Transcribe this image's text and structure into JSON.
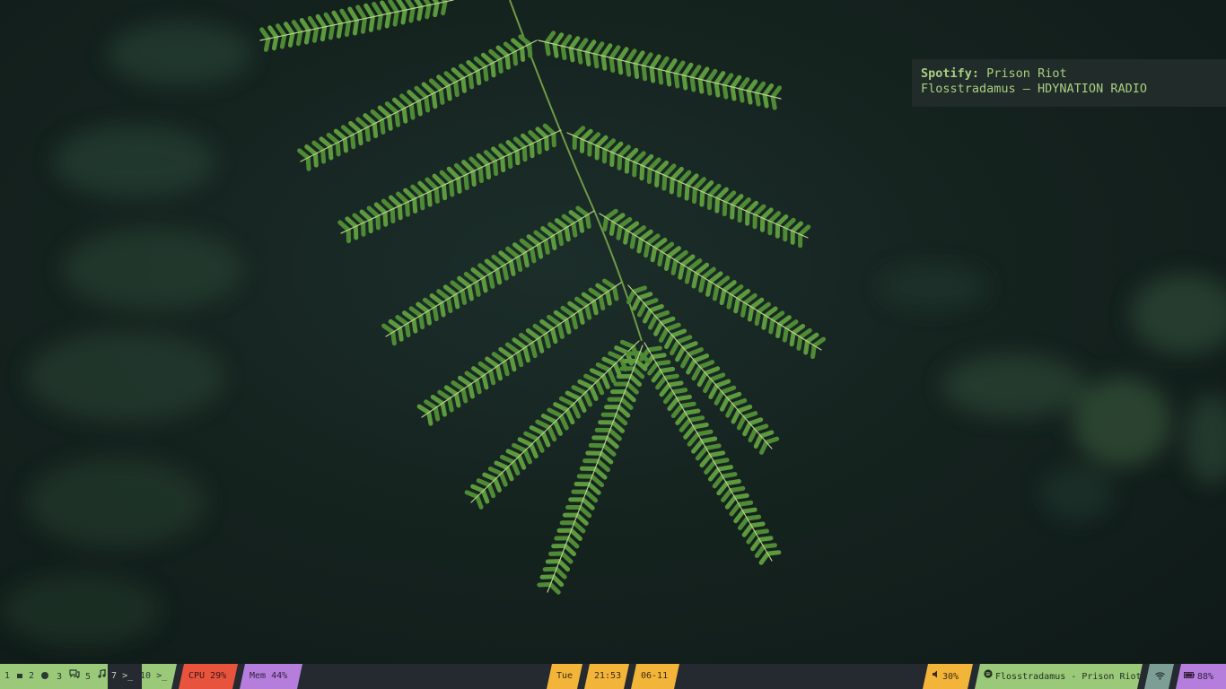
{
  "notification": {
    "app": "Spotify:",
    "title": "Prison Riot",
    "body": "Flosstradamus – HDYNATION RADIO"
  },
  "bar": {
    "workspaces": [
      {
        "num": "1",
        "icon": "window-icon"
      },
      {
        "num": "2",
        "icon": "chrome-icon"
      },
      {
        "num": "3",
        "icon": "chat-icon"
      },
      {
        "num": "5",
        "icon": "music-icon"
      },
      {
        "num": "7",
        "icon": "terminal-icon",
        "active": true
      },
      {
        "num": "10",
        "icon": "terminal-icon"
      }
    ],
    "ws_icon_text": {
      "terminal": ">_"
    },
    "cpu": "CPU 29%",
    "mem": "Mem 44%",
    "day": "Tue",
    "time": "21:53",
    "date": "06-11",
    "volume": "30%",
    "now_playing": "Flosstradamus - Prison Riot",
    "battery": "88%"
  },
  "colors": {
    "green": "#9bc97a",
    "red": "#e8533d",
    "purple": "#b57edc",
    "yellow": "#f2b53a",
    "teal": "#7d9e94",
    "bar_bg": "#252a30"
  }
}
